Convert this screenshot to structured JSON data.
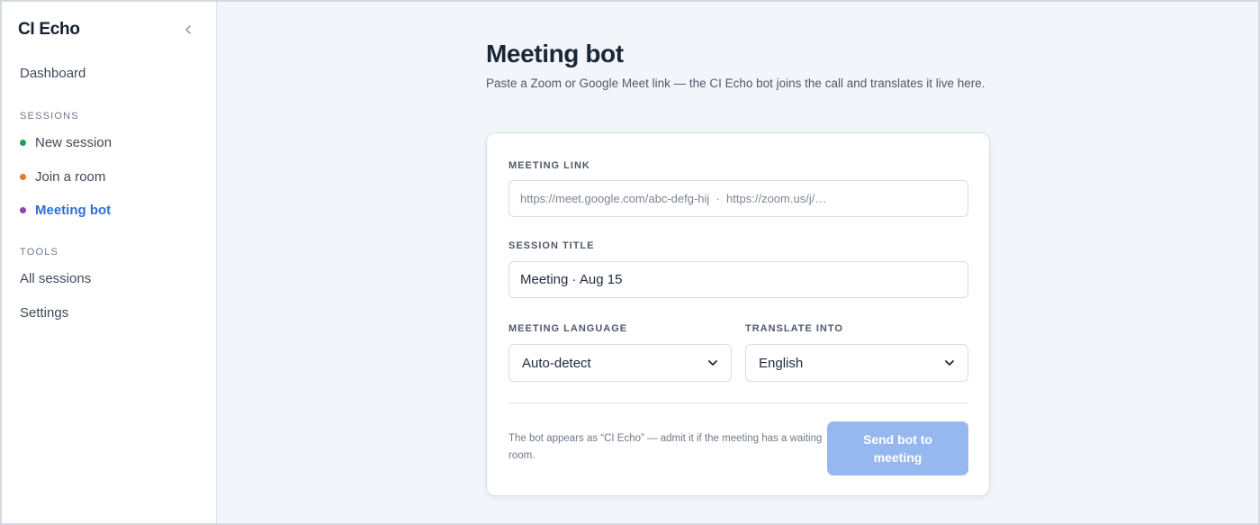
{
  "sidebar": {
    "brand": "CI Echo",
    "collapse_icon": "chevron-left-icon",
    "dashboard": "Dashboard",
    "sessions_label": "SESSIONS",
    "sessions": [
      {
        "label": "New session",
        "dot_color": "#1f9d55"
      },
      {
        "label": "Join a room",
        "dot_color": "#e07b2c"
      },
      {
        "label": "Meeting bot",
        "dot_color": "#8e44ad",
        "active": true
      }
    ],
    "tools_label": "TOOLS",
    "tools": [
      {
        "label": "All sessions"
      },
      {
        "label": "Settings"
      }
    ]
  },
  "main": {
    "title": "Meeting bot",
    "description": "Paste a Zoom or Google Meet link — the CI Echo bot joins the call and translates it live here."
  },
  "form": {
    "meeting_link_label": "MEETING LINK",
    "meeting_link_placeholder": "https://meet.google.com/abc-defg-hij  ·  https://zoom.us/j/…",
    "meeting_link_value": "",
    "session_title_label": "SESSION TITLE",
    "session_title_value": "Meeting · Aug 15",
    "meeting_language_label": "MEETING LANGUAGE",
    "meeting_language_value": "Auto-detect",
    "translate_into_label": "TRANSLATE INTO",
    "translate_into_value": "English",
    "footnote": "The bot appears as “CI Echo” — admit it if the meeting has a waiting room.",
    "submit_label": "Send bot to meeting"
  },
  "colors": {
    "accent": "#2f6fd6",
    "button_disabled": "#96b7f0"
  }
}
